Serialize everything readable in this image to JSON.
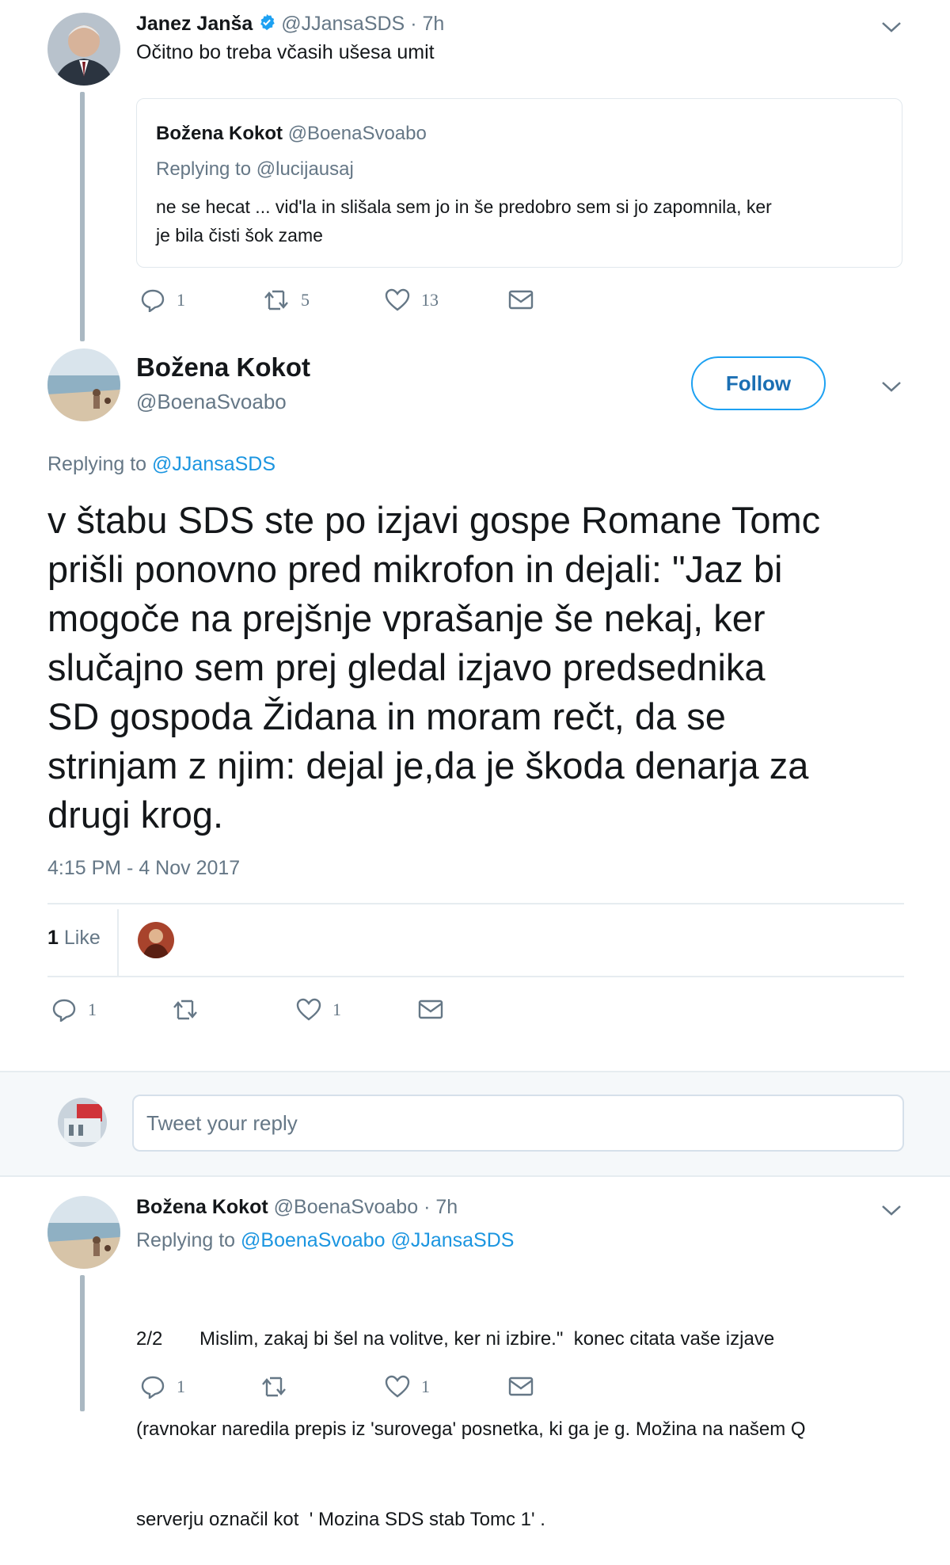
{
  "tweet1": {
    "name": "Janez Janša",
    "handle": "@JJansaSDS",
    "time": "· 7h",
    "text": "Očitno bo treba včasih ušesa umit",
    "quoted": {
      "name": "Božena Kokot",
      "handle": "@BoenaSvoabo",
      "replying_label": "Replying to",
      "replying_to": "@lucijausaj",
      "text_line1": "ne se hecat ... vid'la in slišala sem jo in še predobro sem si jo zapomnila, ker",
      "text_line2": "je bila čisti šok zame"
    },
    "actions": {
      "replies": "1",
      "retweets": "5",
      "likes": "13"
    }
  },
  "main_tweet": {
    "name": "Božena Kokot",
    "handle": "@BoenaSvoabo",
    "follow_label": "Follow",
    "replying_label": "Replying to",
    "replying_to": "@JJansaSDS",
    "lines": [
      "v štabu SDS ste po izjavi gospe Romane Tomc",
      "prišli ponovno pred mikrofon in dejali:  \"Jaz bi",
      "mogoče na prejšnje vprašanje še nekaj, ker",
      "slučajno sem prej gledal izjavo predsednika",
      "SD gospoda Židana in moram rečt, da se",
      "strinjam z njim: dejal je,da je škoda denarja za",
      "drugi krog."
    ],
    "timestamp": "4:15 PM - 4 Nov 2017",
    "like_count": "1",
    "like_label": "Like",
    "actions": {
      "replies": "1",
      "retweets": "",
      "likes": "1"
    }
  },
  "reply_box": {
    "placeholder": "Tweet your reply"
  },
  "tweet3": {
    "name": "Božena Kokot",
    "handle": "@BoenaSvoabo",
    "time": "· 7h",
    "replying_label": "Replying to",
    "replying_to_1": "@BoenaSvoabo",
    "replying_to_2": "@JJansaSDS",
    "line1": "2/2       Mislim, zakaj bi šel na volitve, ker ni izbire.\"  konec citata vaše izjave",
    "line2": "(ravnokar naredila prepis iz 'surovega' posnetka, ki ga je g. Možina na našem Q",
    "line3": "serverju označil kot  ' Mozina SDS stab Tomc 1' .",
    "actions": {
      "replies": "1",
      "retweets": "",
      "likes": "1"
    }
  },
  "colors": {
    "link": "#1b95e0",
    "muted": "#657786",
    "border": "#e1e8ed",
    "verified": "#1da1f2"
  }
}
